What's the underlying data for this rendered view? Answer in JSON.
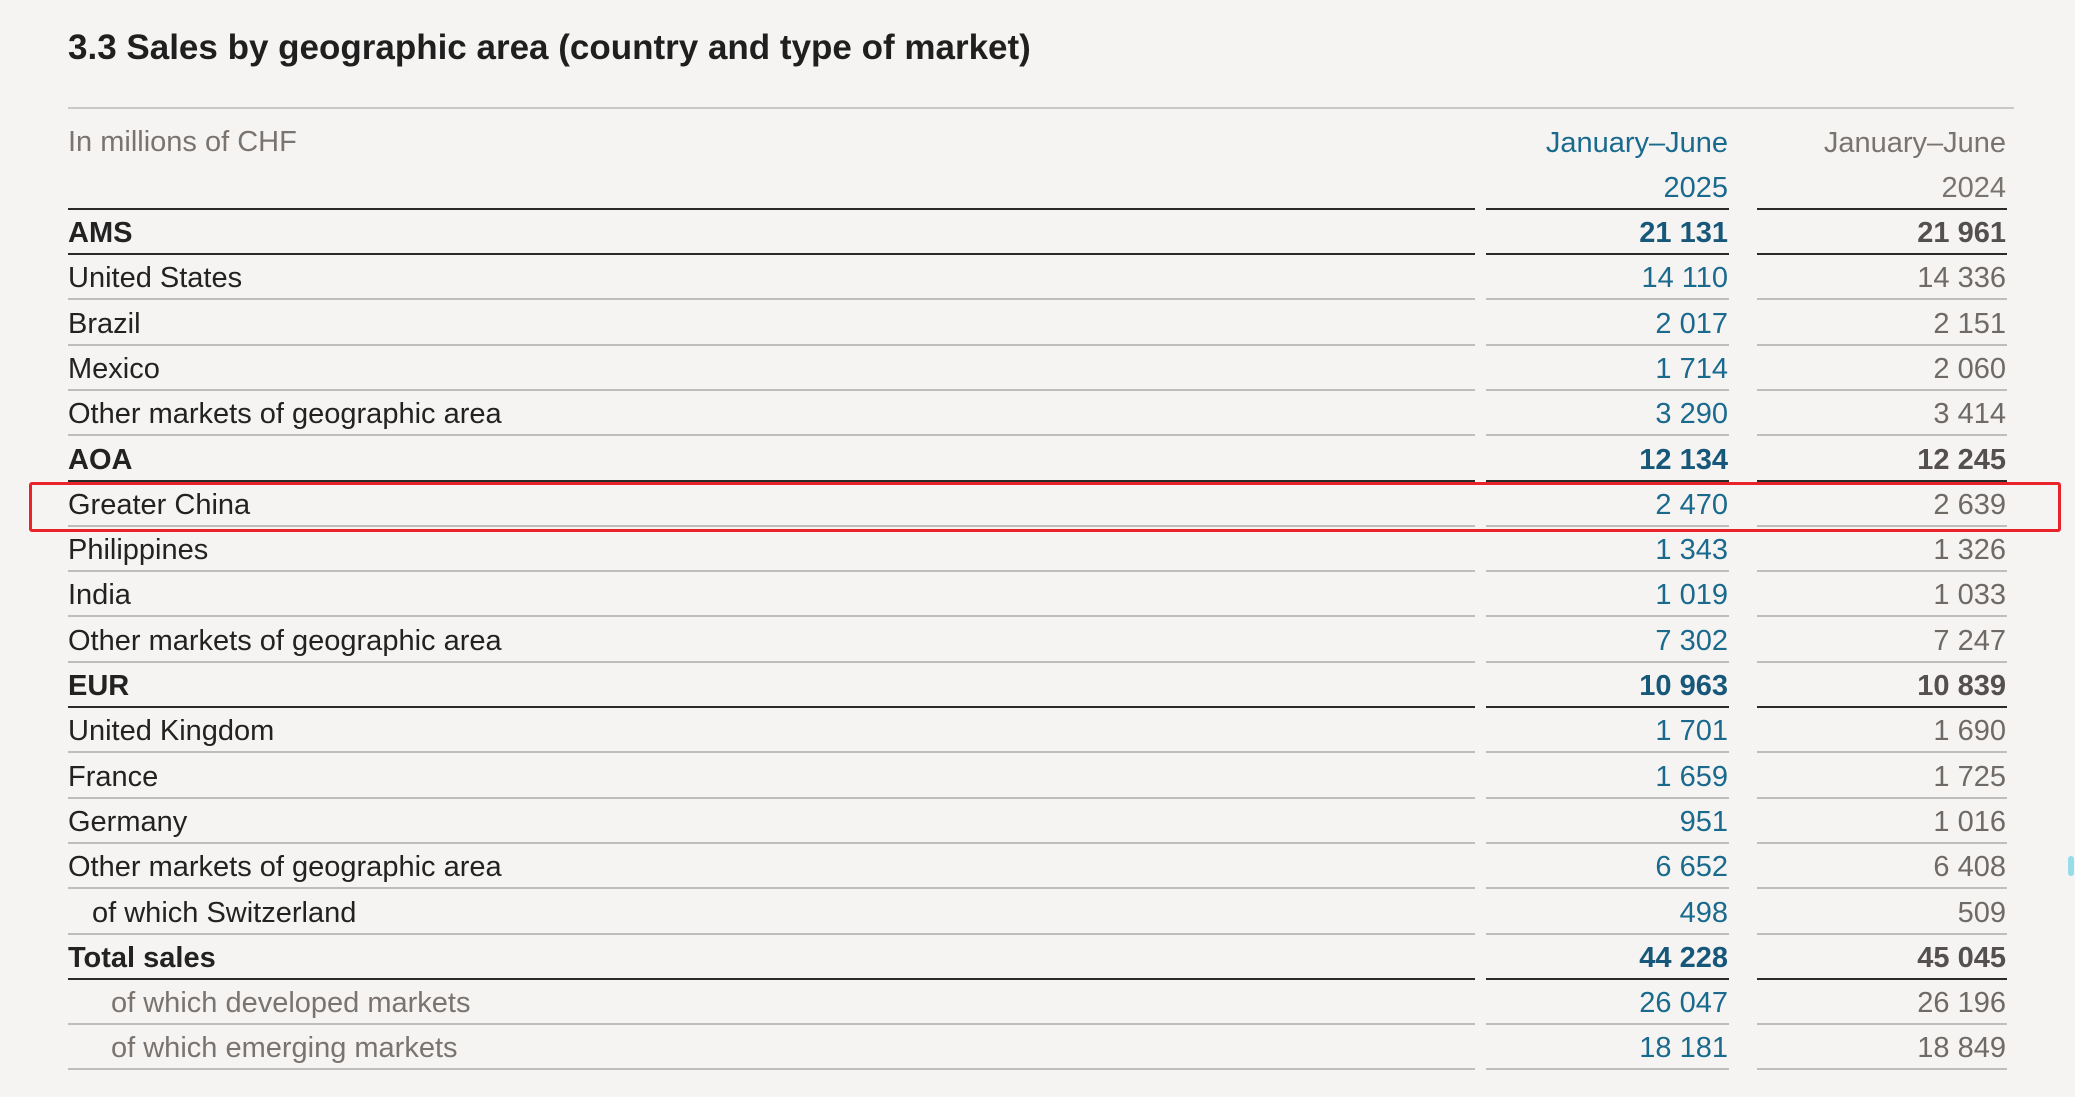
{
  "title": "3.3 Sales by geographic area (country and type of market)",
  "units": "In millions of CHF",
  "columns": {
    "current": {
      "period": "January–June",
      "year": "2025"
    },
    "previous": {
      "period": "January–June",
      "year": "2024"
    }
  },
  "rows": [
    {
      "label": "AMS",
      "cur": "21 131",
      "prev": "21 961",
      "style": "bold"
    },
    {
      "label": "United States",
      "cur": "14 110",
      "prev": "14 336",
      "style": "normal"
    },
    {
      "label": "Brazil",
      "cur": "2 017",
      "prev": "2 151",
      "style": "normal"
    },
    {
      "label": "Mexico",
      "cur": "1 714",
      "prev": "2 060",
      "style": "normal"
    },
    {
      "label": "Other markets of geographic area",
      "cur": "3 290",
      "prev": "3 414",
      "style": "normal"
    },
    {
      "label": "AOA",
      "cur": "12 134",
      "prev": "12 245",
      "style": "bold"
    },
    {
      "label": "Greater China",
      "cur": "2 470",
      "prev": "2 639",
      "style": "normal"
    },
    {
      "label": "Philippines",
      "cur": "1 343",
      "prev": "1 326",
      "style": "normal"
    },
    {
      "label": "India",
      "cur": "1 019",
      "prev": "1 033",
      "style": "normal"
    },
    {
      "label": "Other markets of geographic area",
      "cur": "7 302",
      "prev": "7 247",
      "style": "normal"
    },
    {
      "label": "EUR",
      "cur": "10 963",
      "prev": "10 839",
      "style": "bold"
    },
    {
      "label": "United Kingdom",
      "cur": "1 701",
      "prev": "1 690",
      "style": "normal"
    },
    {
      "label": "France",
      "cur": "1 659",
      "prev": "1 725",
      "style": "normal"
    },
    {
      "label": "Germany",
      "cur": "951",
      "prev": "1 016",
      "style": "normal"
    },
    {
      "label": "Other markets of geographic area",
      "cur": "6 652",
      "prev": "6 408",
      "style": "normal"
    },
    {
      "label": "of which Switzerland",
      "cur": "498",
      "prev": "509",
      "style": "indent1"
    },
    {
      "label": "Total sales",
      "cur": "44 228",
      "prev": "45 045",
      "style": "bold"
    },
    {
      "label": "of which developed markets",
      "cur": "26 047",
      "prev": "26 196",
      "style": "indent2"
    },
    {
      "label": "of which emerging markets",
      "cur": "18 181",
      "prev": "18 849",
      "style": "indent2"
    }
  ],
  "highlight": {
    "row_label": "Greater China",
    "color": "#e8242a"
  },
  "colors": {
    "current_column": "#1a6a8e",
    "previous_column": "#6f6a66",
    "background": "#f5f4f2"
  }
}
